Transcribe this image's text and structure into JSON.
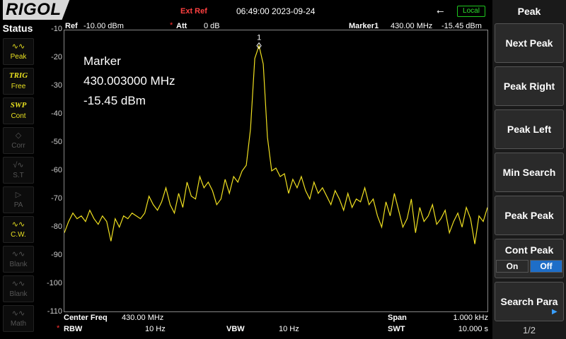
{
  "header": {
    "brand": "RIGOL",
    "ext_ref": "Ext Ref",
    "datetime": "06:49:00 2023-09-24",
    "usb_icon": "usb-icon",
    "local": "Local"
  },
  "status": {
    "title": "Status",
    "items": [
      {
        "icon": "peak-icon",
        "label": "Peak",
        "active": true
      },
      {
        "icon": "TRIG",
        "label": "Free",
        "active": true
      },
      {
        "icon": "SWP",
        "label": "Cont",
        "active": true
      },
      {
        "icon": "corr-icon",
        "label": "Corr",
        "active": false
      },
      {
        "icon": "st-icon",
        "label": "S.T",
        "active": false
      },
      {
        "icon": "pa-icon",
        "label": "PA",
        "active": false
      },
      {
        "icon": "cw-icon",
        "label": "C.W.",
        "active": true
      },
      {
        "icon": "blank-icon",
        "label": "Blank",
        "active": false
      },
      {
        "icon": "blank-icon",
        "label": "Blank",
        "active": false
      },
      {
        "icon": "math-icon",
        "label": "Math",
        "active": false
      }
    ]
  },
  "plot_header": {
    "ref_label": "Ref",
    "ref_value": "-10.00 dBm",
    "att_label": "Att",
    "att_value": "0 dB",
    "marker_label": "Marker1",
    "marker_freq": "430.00 MHz",
    "marker_amp": "-15.45 dBm"
  },
  "marker_readout": {
    "title": "Marker",
    "freq": "430.003000 MHz",
    "amp": "-15.45 dBm",
    "tag": "1"
  },
  "footer": {
    "center_label": "Center Freq",
    "center_value": "430.00 MHz",
    "span_label": "Span",
    "span_value": "1.000 kHz",
    "rbw_label": "RBW",
    "rbw_value": "10 Hz",
    "vbw_label": "VBW",
    "vbw_value": "10 Hz",
    "swt_label": "SWT",
    "swt_value": "10.000 s"
  },
  "menu": {
    "title": "Peak",
    "items": [
      "Next Peak",
      "Peak Right",
      "Peak Left",
      "Min Search",
      "Peak Peak"
    ],
    "cont_peak": {
      "label": "Cont Peak",
      "on": "On",
      "off": "Off",
      "selected": "Off"
    },
    "search_para": "Search Para",
    "page": "1/2"
  },
  "chart_data": {
    "type": "line",
    "ylim": [
      -110,
      -10
    ],
    "yticks": [
      "-10",
      "-20",
      "-30",
      "-40",
      "-50",
      "-60",
      "-70",
      "-80",
      "-90",
      "-100",
      "-110"
    ],
    "trace_color": "#f0e020",
    "grid": false,
    "x": [
      0,
      1,
      2,
      3,
      4,
      5,
      6,
      7,
      8,
      9,
      10,
      11,
      12,
      13,
      14,
      15,
      16,
      17,
      18,
      19,
      20,
      21,
      22,
      23,
      24,
      25,
      26,
      27,
      28,
      29,
      30,
      31,
      32,
      33,
      34,
      35,
      36,
      37,
      38,
      39,
      40,
      41,
      42,
      43,
      44,
      45,
      46,
      47,
      48,
      49,
      50,
      51,
      52,
      53,
      54,
      55,
      56,
      57,
      58,
      59,
      60,
      61,
      62,
      63,
      64,
      65,
      66,
      67,
      68,
      69,
      70,
      71,
      72,
      73,
      74,
      75,
      76,
      77,
      78,
      79,
      80,
      81,
      82,
      83,
      84,
      85,
      86,
      87,
      88,
      89,
      90,
      91,
      92,
      93,
      94,
      95,
      96,
      97,
      98,
      99,
      100
    ],
    "values": [
      -82,
      -78,
      -75,
      -77,
      -76,
      -78,
      -74,
      -77,
      -79,
      -76,
      -78,
      -85,
      -77,
      -80,
      -76,
      -77,
      -75,
      -76,
      -77,
      -75,
      -69,
      -72,
      -74,
      -71,
      -66,
      -72,
      -75,
      -68,
      -73,
      -64,
      -69,
      -70,
      -62,
      -66,
      -64,
      -67,
      -72,
      -70,
      -63,
      -68,
      -62,
      -64,
      -60,
      -58,
      -45,
      -20,
      -15.45,
      -22,
      -48,
      -60,
      -59,
      -62,
      -61,
      -68,
      -63,
      -66,
      -62,
      -67,
      -70,
      -64,
      -68,
      -66,
      -69,
      -72,
      -67,
      -70,
      -74,
      -68,
      -73,
      -70,
      -71,
      -66,
      -72,
      -70,
      -76,
      -80,
      -71,
      -76,
      -68,
      -74,
      -80,
      -77,
      -70,
      -82,
      -73,
      -78,
      -76,
      -72,
      -79,
      -77,
      -74,
      -82,
      -78,
      -75,
      -80,
      -73,
      -77,
      -86,
      -76,
      -78,
      -73
    ]
  }
}
